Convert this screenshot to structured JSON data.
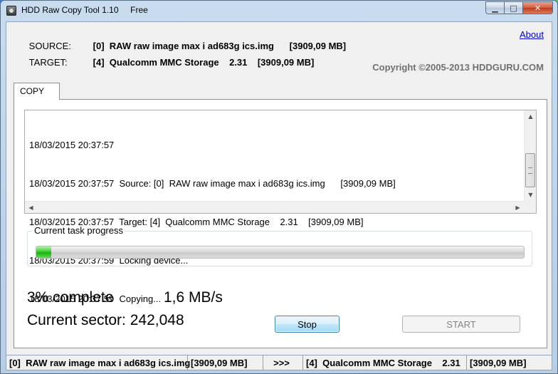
{
  "window": {
    "title": "HDD Raw Copy Tool 1.10     Free",
    "minimize_glyph": "▁",
    "maximize_glyph": "□",
    "close_glyph": "✕"
  },
  "header": {
    "source_label": "SOURCE:",
    "source_value": "[0]  RAW raw image max i ad683g ics.img      [3909,09 MB]",
    "target_label": "TARGET:",
    "target_value": "[4]  Qualcomm MMC Storage    2.31    [3909,09 MB]",
    "about_link": "About",
    "copyright": "Copyright ©2005-2013 HDDGURU.COM"
  },
  "tabs": [
    {
      "label": "COPY",
      "active": true
    }
  ],
  "log": {
    "lines": [
      "18/03/2015 20:37:57",
      "18/03/2015 20:37:57  Source: [0]  RAW raw image max i ad683g ics.img      [3909,09 MB]",
      "18/03/2015 20:37:57  Target: [4]  Qualcomm MMC Storage    2.31    [3909,09 MB]",
      "18/03/2015 20:37:59  Locking device...",
      "18/03/2015 20:37:59  Copying..."
    ]
  },
  "progress": {
    "group_label": "Current task progress",
    "fraction": 0.03,
    "color": "#22c11a"
  },
  "stats": {
    "percent_text": "3% complete",
    "speed_text": "1,6 MB/s",
    "sector_text": "Current sector: 242,048"
  },
  "buttons": {
    "stop_label": "Stop",
    "start_label": "START"
  },
  "statusbar": {
    "source": "[0]  RAW raw image max i ad683g ics.img",
    "source_size": "[3909,09 MB]",
    "arrow": ">>>",
    "target": "[4]  Qualcomm MMC Storage    2.31",
    "target_size": "[3909,09 MB]"
  }
}
